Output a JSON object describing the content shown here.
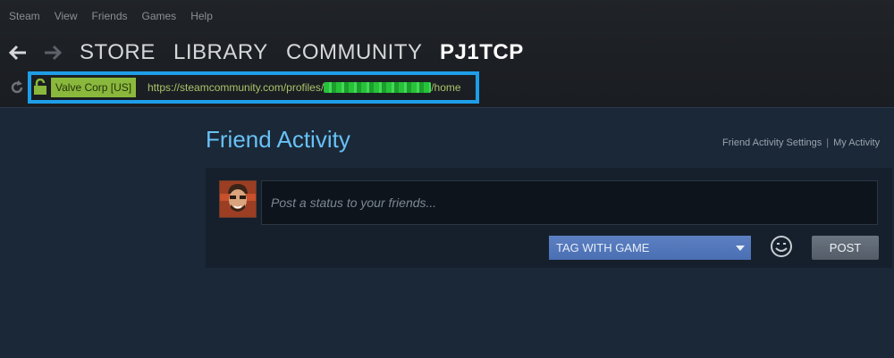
{
  "menu": [
    "Steam",
    "View",
    "Friends",
    "Games",
    "Help"
  ],
  "nav": {
    "store": "STORE",
    "library": "LIBRARY",
    "community": "COMMUNITY",
    "user": "PJ1TCP"
  },
  "address": {
    "cert_label": "Valve Corp [US]",
    "url_prefix": "https://steamcommunity.com/profiles/",
    "url_suffix": "/home"
  },
  "activity": {
    "title": "Friend Activity",
    "settings_link": "Friend Activity Settings",
    "separator": "|",
    "my_activity_link": "My Activity",
    "status_placeholder": "Post a status to your friends...",
    "tag_label": "TAG WITH GAME",
    "post_label": "POST"
  },
  "colors": {
    "highlight_border": "#1e9ee8",
    "title_blue": "#67c1f5",
    "cert_green": "#8ab83c",
    "background": "#1b2838"
  }
}
